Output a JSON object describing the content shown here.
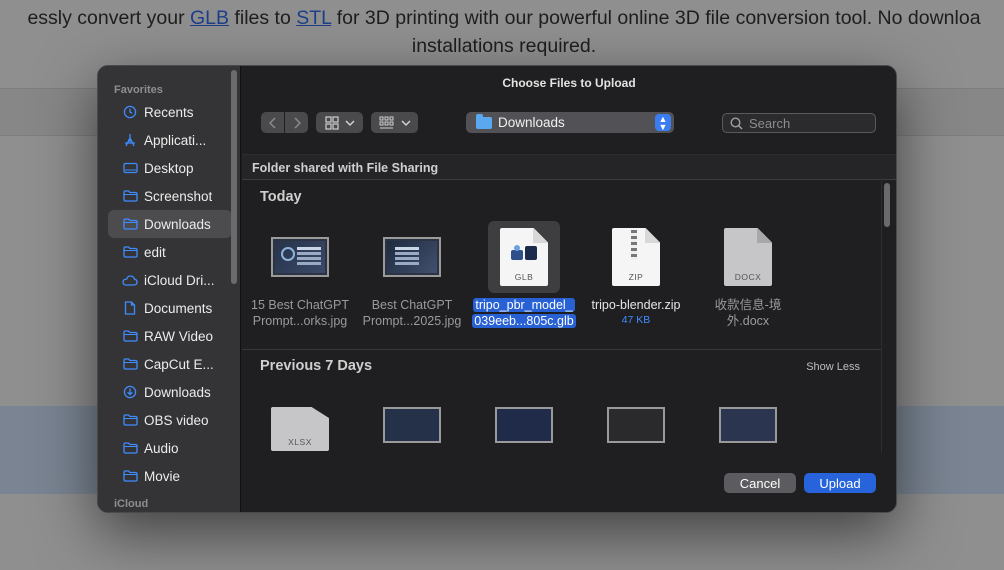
{
  "background": {
    "line1_before": "essly convert your ",
    "link1": "GLB",
    "line1_mid": " files to ",
    "link2": "STL",
    "line1_after": " for 3D printing with our powerful online 3D file conversion tool. No downloa",
    "line2": "installations required."
  },
  "dialog": {
    "title": "Choose Files to Upload",
    "location": "Downloads",
    "search_placeholder": "Search",
    "shared_label": "Folder shared with File Sharing",
    "section_today": "Today",
    "section_prev": "Previous 7 Days",
    "show_less": "Show Less",
    "cancel": "Cancel",
    "upload": "Upload"
  },
  "sidebar": {
    "favorites_label": "Favorites",
    "items": [
      {
        "label": "Recents",
        "icon": "clock-icon"
      },
      {
        "label": "Applicati...",
        "icon": "apps-icon"
      },
      {
        "label": "Desktop",
        "icon": "desktop-icon"
      },
      {
        "label": "Screenshot",
        "icon": "folder-icon"
      },
      {
        "label": "Downloads",
        "icon": "folder-icon",
        "active": true
      },
      {
        "label": "edit",
        "icon": "folder-icon"
      },
      {
        "label": "iCloud Dri...",
        "icon": "cloud-icon"
      },
      {
        "label": "Documents",
        "icon": "doc-icon"
      },
      {
        "label": "RAW Video",
        "icon": "folder-icon"
      },
      {
        "label": "CapCut E...",
        "icon": "folder-icon"
      },
      {
        "label": "Downloads",
        "icon": "download-icon"
      },
      {
        "label": "OBS video",
        "icon": "folder-icon"
      },
      {
        "label": "Audio",
        "icon": "folder-icon"
      },
      {
        "label": "Movie",
        "icon": "folder-icon"
      }
    ],
    "icloud_label": "iCloud"
  },
  "files_today": [
    {
      "line1": "15 Best ChatGPT",
      "line2": "Prompt...orks.jpg"
    },
    {
      "line1": "Best ChatGPT",
      "line2": "Prompt...2025.jpg"
    },
    {
      "line1": "tripo_pbr_model_",
      "line2": "039eeb...805c.glb",
      "ext": "GLB"
    },
    {
      "line1": "tripo-blender.zip",
      "size": "47 KB",
      "ext": "ZIP"
    },
    {
      "line1": "收款信息-境",
      "line2": "外.docx",
      "ext": "DOCX"
    }
  ],
  "files_prev": [
    {
      "ext": "XLSX"
    }
  ]
}
